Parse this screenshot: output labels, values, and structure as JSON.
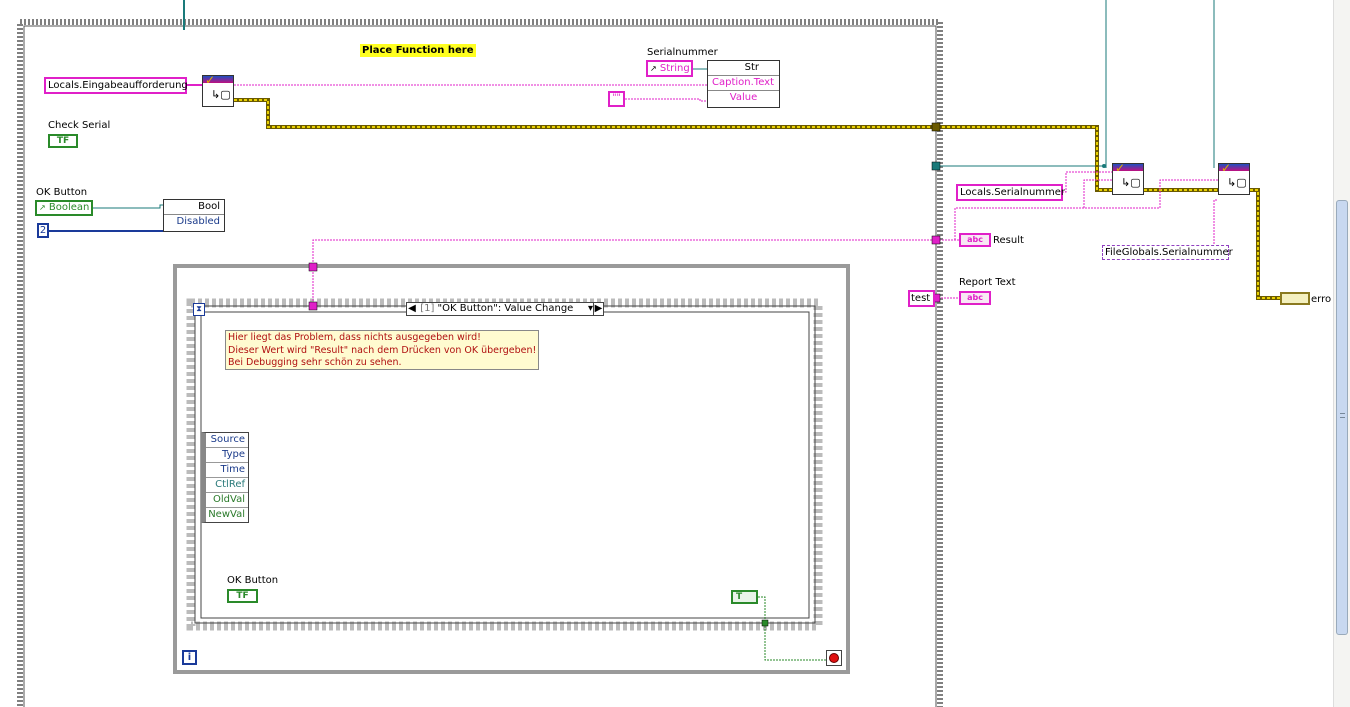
{
  "title_label": "Place Function here",
  "locals_eingabe": "Locals.Eingabeaufforderung",
  "check_serial": {
    "label": "Check Serial",
    "value": "TF"
  },
  "ok_button_outer": {
    "label": "OK Button",
    "control": "Boolean"
  },
  "numeric_const": "2",
  "bool_node": {
    "header": "Bool",
    "prop": "Disabled"
  },
  "serialnummer": {
    "label": "Serialnummer",
    "control": "String"
  },
  "str_node": {
    "header": "Str",
    "prop1": "Caption.Text",
    "prop2": "Value"
  },
  "empty_string": "\"\"",
  "result_indicator": {
    "label": "Result",
    "glyph": "abc"
  },
  "report_text": {
    "label": "Report Text",
    "value": "test",
    "glyph": "abc"
  },
  "locals_serial": "Locals.Serialnummer",
  "fileglobals_serial": "FileGlobals.Serialnummer",
  "error_label": "erro",
  "event_selector": {
    "index": "[1]",
    "text": "\"OK Button\": Value Change"
  },
  "comment": {
    "line1": "Hier liegt das Problem, dass nichts ausgegeben wird!",
    "line2": "Dieser Wert wird \"Result\" nach dem Drücken von OK übergeben!",
    "line3": "Bei Debugging sehr schön zu sehen."
  },
  "event_data": [
    "Source",
    "Type",
    "Time",
    "CtlRef",
    "OldVal",
    "NewVal"
  ],
  "ok_button_inner": {
    "label": "OK Button",
    "value": "TF"
  },
  "true_const": "T",
  "loop_iter": "i",
  "colors": {
    "pink_wire": "#e020c8",
    "error_wire": "#c8b400",
    "ref_wire": "#1a7a7a",
    "bool_wire": "#2a8a2a",
    "num_wire": "#1a3a9a"
  }
}
